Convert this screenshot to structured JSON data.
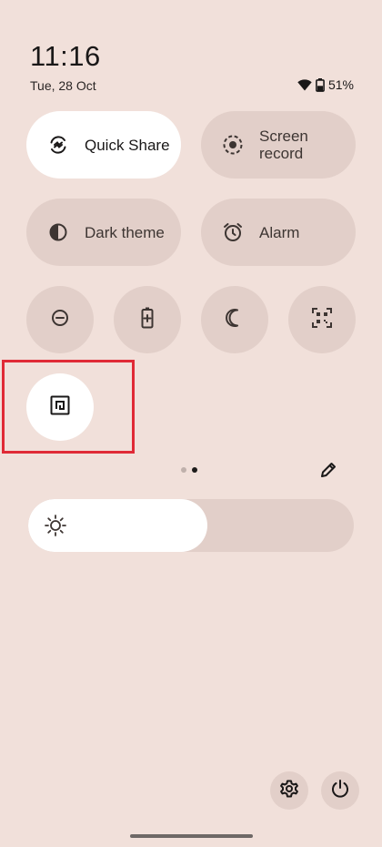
{
  "status_bar": {
    "time": "11:16",
    "date": "Tue, 28 Oct",
    "battery_percent": "51%",
    "battery_level": 0.51,
    "icons": [
      "wifi-icon",
      "battery-icon"
    ]
  },
  "tiles_large": [
    {
      "label": "Quick Share",
      "icon": "quick-share-icon",
      "active": true
    },
    {
      "label": "Screen record",
      "icon": "screen-record-icon",
      "active": false
    },
    {
      "label": "Dark theme",
      "icon": "dark-theme-icon",
      "active": false
    },
    {
      "label": "Alarm",
      "icon": "alarm-icon",
      "active": false
    }
  ],
  "tiles_small": [
    {
      "icon": "do-not-disturb-icon",
      "active": false
    },
    {
      "icon": "battery-saver-icon",
      "active": false
    },
    {
      "icon": "bedtime-moon-icon",
      "active": false
    },
    {
      "icon": "qr-scanner-icon",
      "active": false
    },
    {
      "icon": "nfc-icon",
      "active": true
    }
  ],
  "pager": {
    "pages": 2,
    "current": 2
  },
  "brightness": {
    "level": 0.55
  },
  "bottom_actions": [
    "settings-icon",
    "power-icon"
  ],
  "colors": {
    "background": "#f1e0da",
    "tile_inactive": "#e2cfc9",
    "tile_active": "#ffffff",
    "highlight": "#e02a36"
  }
}
